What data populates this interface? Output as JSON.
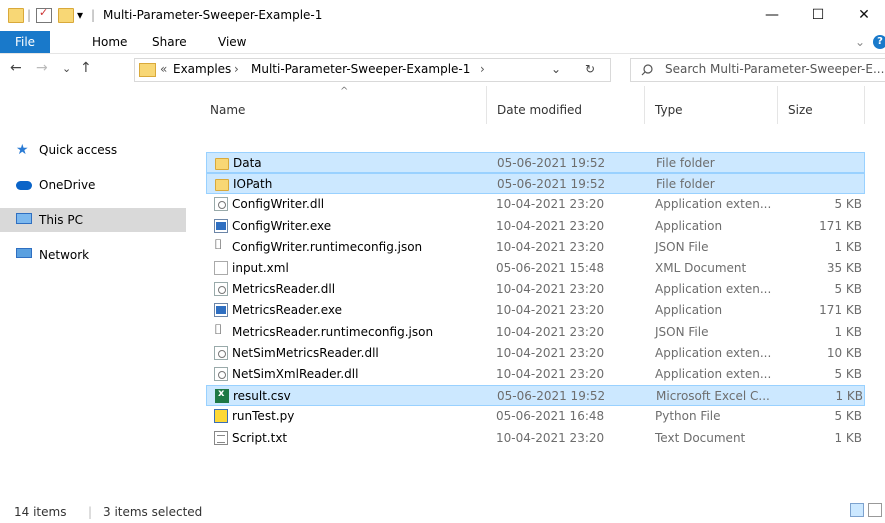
{
  "window": {
    "title": "Multi-Parameter-Sweeper-Example-1",
    "qa_separator": "|",
    "qa_dropdown": "▾",
    "minimize": "—",
    "maximize": "☐",
    "close": "✕"
  },
  "ribbon": {
    "tabs": [
      "File",
      "Home",
      "Share",
      "View"
    ],
    "expand_icon": "⌄",
    "help_icon": "?"
  },
  "address": {
    "back": "←",
    "forward": "→",
    "recent": "⌄",
    "up": "↑",
    "overflow": "«",
    "crumbs": [
      "Examples",
      "Multi-Parameter-Sweeper-Example-1"
    ],
    "sep": "›",
    "dropdown": "⌄",
    "refresh": "↻",
    "search_placeholder": "Search Multi-Parameter-Sweeper-E..."
  },
  "nav": {
    "items": [
      {
        "label": "Quick access",
        "icon": "star-icon",
        "selected": false
      },
      {
        "label": "OneDrive",
        "icon": "cloud-icon",
        "selected": false
      },
      {
        "label": "This PC",
        "icon": "monitor-icon",
        "selected": true
      },
      {
        "label": "Network",
        "icon": "network-icon",
        "selected": false
      }
    ]
  },
  "list": {
    "sort_indicator": "^",
    "columns": [
      "Name",
      "Date modified",
      "Type",
      "Size"
    ],
    "rows": [
      {
        "name": "Data",
        "date": "05-06-2021 19:52",
        "type": "File folder",
        "size": "",
        "icon": "folder",
        "selected": true
      },
      {
        "name": "IOPath",
        "date": "05-06-2021 19:52",
        "type": "File folder",
        "size": "",
        "icon": "folder",
        "selected": true
      },
      {
        "name": "ConfigWriter.dll",
        "date": "10-04-2021 23:20",
        "type": "Application exten...",
        "size": "5 KB",
        "icon": "dll",
        "selected": false
      },
      {
        "name": "ConfigWriter.exe",
        "date": "10-04-2021 23:20",
        "type": "Application",
        "size": "171 KB",
        "icon": "exe",
        "selected": false
      },
      {
        "name": "ConfigWriter.runtimeconfig.json",
        "date": "10-04-2021 23:20",
        "type": "JSON File",
        "size": "1 KB",
        "icon": "json",
        "selected": false
      },
      {
        "name": "input.xml",
        "date": "05-06-2021 15:48",
        "type": "XML Document",
        "size": "35 KB",
        "icon": "xml",
        "selected": false
      },
      {
        "name": "MetricsReader.dll",
        "date": "10-04-2021 23:20",
        "type": "Application exten...",
        "size": "5 KB",
        "icon": "dll",
        "selected": false
      },
      {
        "name": "MetricsReader.exe",
        "date": "10-04-2021 23:20",
        "type": "Application",
        "size": "171 KB",
        "icon": "exe",
        "selected": false
      },
      {
        "name": "MetricsReader.runtimeconfig.json",
        "date": "10-04-2021 23:20",
        "type": "JSON File",
        "size": "1 KB",
        "icon": "json",
        "selected": false
      },
      {
        "name": "NetSimMetricsReader.dll",
        "date": "10-04-2021 23:20",
        "type": "Application exten...",
        "size": "10 KB",
        "icon": "dll",
        "selected": false
      },
      {
        "name": "NetSimXmlReader.dll",
        "date": "10-04-2021 23:20",
        "type": "Application exten...",
        "size": "5 KB",
        "icon": "dll",
        "selected": false
      },
      {
        "name": "result.csv",
        "date": "05-06-2021 19:52",
        "type": "Microsoft Excel C...",
        "size": "1 KB",
        "icon": "csv",
        "selected": true
      },
      {
        "name": "runTest.py",
        "date": "05-06-2021 16:48",
        "type": "Python File",
        "size": "5 KB",
        "icon": "py",
        "selected": false
      },
      {
        "name": "Script.txt",
        "date": "10-04-2021 23:20",
        "type": "Text Document",
        "size": "1 KB",
        "icon": "txt",
        "selected": false
      }
    ]
  },
  "status": {
    "item_count": "14 items",
    "selected_count": "3 items selected"
  },
  "colors": {
    "accent": "#1979ca",
    "selection": "#cce8ff"
  }
}
